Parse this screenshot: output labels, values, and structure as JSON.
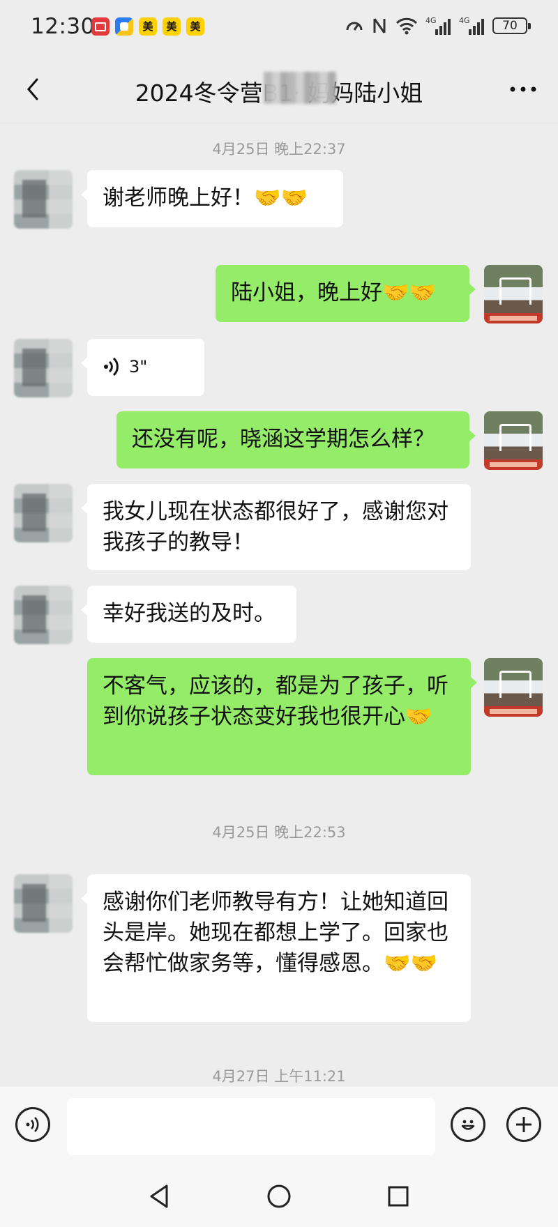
{
  "status_bar": {
    "time": "12:30",
    "app_badges": [
      "美",
      "美",
      "美"
    ],
    "network_1": "4G",
    "network_2": "4G",
    "battery": "70"
  },
  "header": {
    "title": "2024冬令营B1·        妈妈陆小姐"
  },
  "messages": [
    {
      "type": "timestamp",
      "text": "4月25日 晚上22:37"
    },
    {
      "type": "text",
      "side": "left",
      "text": "谢老师晚上好！🤝🤝"
    },
    {
      "type": "text",
      "side": "right",
      "text": "陆小姐，晚上好🤝🤝"
    },
    {
      "type": "voice",
      "side": "left",
      "duration": "3\""
    },
    {
      "type": "text",
      "side": "right",
      "text": "还没有呢，晓涵这学期怎么样？"
    },
    {
      "type": "text",
      "side": "left",
      "text": "我女儿现在状态都很好了，感谢您对我孩子的教导！"
    },
    {
      "type": "text",
      "side": "left",
      "text": "幸好我送的及时。"
    },
    {
      "type": "text",
      "side": "right",
      "text": "不客气，应该的，都是为了孩子，听到你说孩子状态变好我也很开心🤝"
    },
    {
      "type": "timestamp",
      "text": "4月25日 晚上22:53"
    },
    {
      "type": "text",
      "side": "left",
      "text": "感谢你们老师教导有方！让她知道回头是岸。她现在都想上学了。回家也会帮忙做家务等，懂得感恩。🤝🤝"
    },
    {
      "type": "timestamp",
      "text": "4月27日 上午11:21"
    }
  ],
  "input_bar": {
    "placeholder": ""
  }
}
